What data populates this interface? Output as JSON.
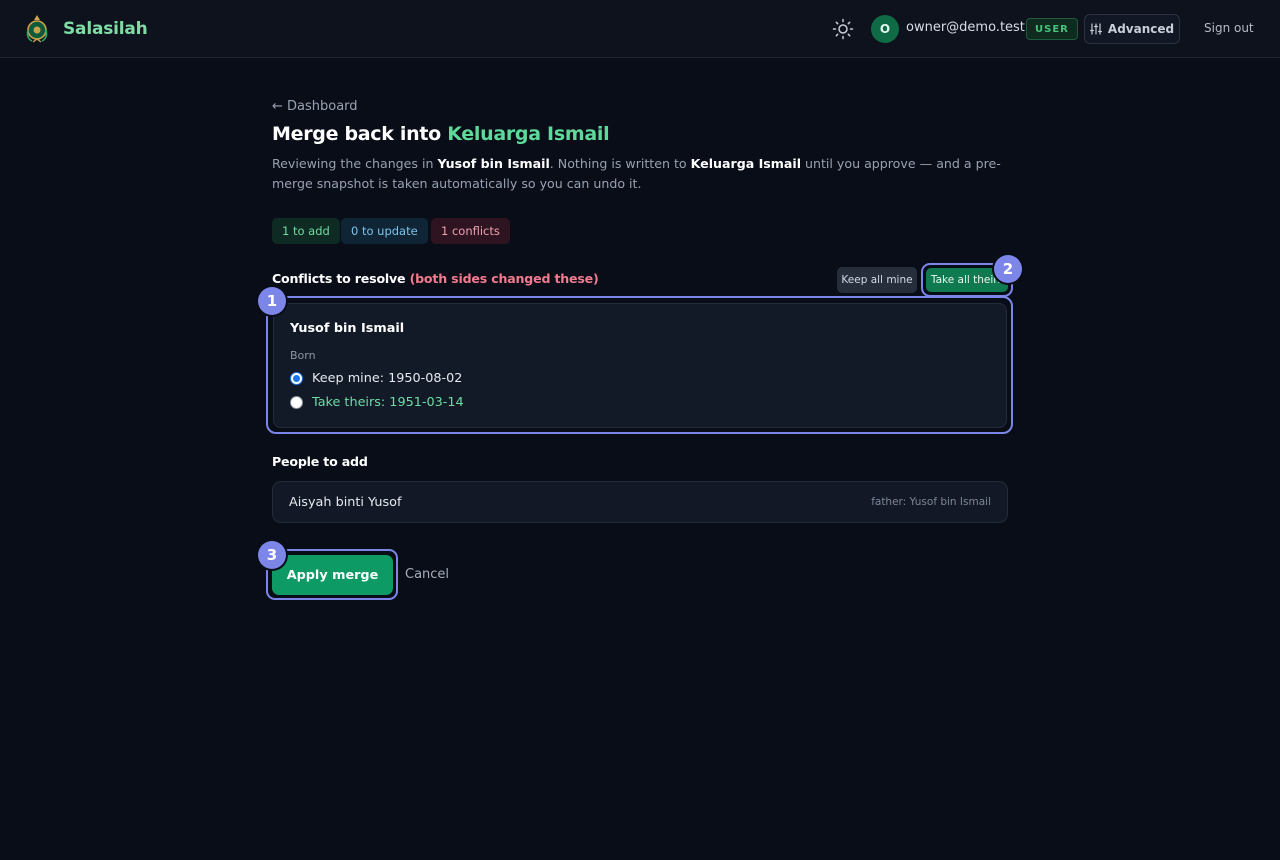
{
  "header": {
    "app_name": "Salasilah",
    "avatar_initial": "O",
    "user_email": "owner@demo.test",
    "role_badge": "USER",
    "advanced_label": "Advanced",
    "signout_label": "Sign out",
    "icons": [
      "crest-logo-icon",
      "sun-icon",
      "sliders-icon"
    ]
  },
  "page": {
    "back_link": "← Dashboard",
    "title_prefix": "Merge back into",
    "title_target": "Keluarga Ismail",
    "intro": {
      "part1": "Reviewing the changes in ",
      "source": "Yusof bin Ismail",
      "part2": ". Nothing is written to ",
      "target": "Keluarga Ismail",
      "part3": " until you approve — and a pre-merge snapshot is taken automatically so you can undo it."
    },
    "summary": {
      "add": "1 to add",
      "update": "0 to update",
      "conflicts": "1 conflicts"
    }
  },
  "conflicts": {
    "heading": "Conflicts to resolve",
    "heading_note": "(both sides changed these)",
    "keep_all_label": "Keep all mine",
    "take_all_label": "Take all theirs",
    "items": [
      {
        "person": "Yusof bin Ismail",
        "field": "Born",
        "mine": "Keep mine: 1950-08-02",
        "theirs": "Take theirs: 1951-03-14",
        "selected": "mine"
      }
    ]
  },
  "people_to_add": {
    "heading": "People to add",
    "items": [
      {
        "name": "Aisyah binti Yusof",
        "note": "father: Yusof bin Ismail"
      }
    ]
  },
  "actions": {
    "apply_label": "Apply merge",
    "cancel_label": "Cancel"
  },
  "markers": [
    "1",
    "2",
    "3"
  ],
  "colors": {
    "background": "#090d18",
    "accent_green": "#5dd99a",
    "primary_button": "#0e9a64",
    "highlight": "#7b86e8",
    "conflict_red": "#f27a8e"
  }
}
